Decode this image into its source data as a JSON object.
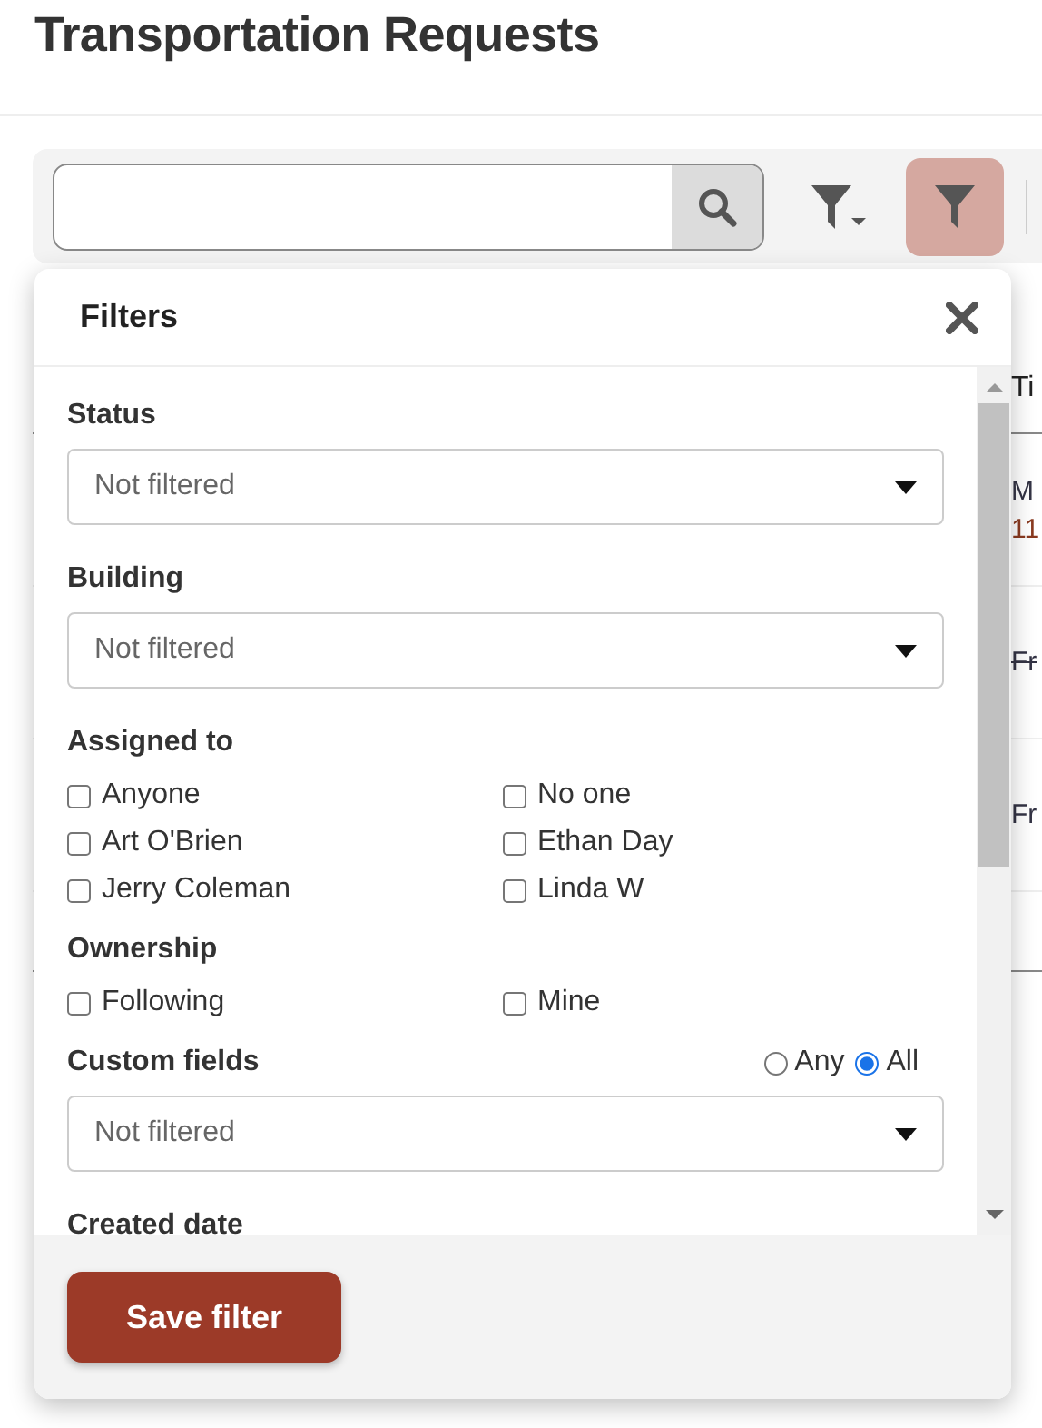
{
  "page": {
    "title": "Transportation Requests"
  },
  "toolbar": {
    "filter_toggle": {
      "active": true
    }
  },
  "background_table": {
    "header": "Ti",
    "rows": [
      {
        "lines": [
          "M",
          "11"
        ],
        "strikethrough": false
      },
      {
        "lines": [
          "Fr"
        ],
        "strikethrough": true
      },
      {
        "lines": [
          "Fr"
        ],
        "strikethrough": false
      }
    ]
  },
  "filters_panel": {
    "title": "Filters",
    "sections": [
      {
        "kind": "select",
        "label": "Status",
        "value": "Not filtered"
      },
      {
        "kind": "select",
        "label": "Building",
        "value": "Not filtered"
      },
      {
        "kind": "checkboxes",
        "label": "Assigned to",
        "options": [
          {
            "label": "Anyone",
            "checked": false
          },
          {
            "label": "No one",
            "checked": false
          },
          {
            "label": "Art O'Brien",
            "checked": false
          },
          {
            "label": "Ethan Day",
            "checked": false
          },
          {
            "label": "Jerry Coleman",
            "checked": false
          },
          {
            "label": "Linda W",
            "checked": false
          }
        ]
      },
      {
        "kind": "checkboxes",
        "label": "Ownership",
        "options": [
          {
            "label": "Following",
            "checked": false
          },
          {
            "label": "Mine",
            "checked": false
          }
        ]
      },
      {
        "kind": "select",
        "label": "Custom fields",
        "value": "Not filtered",
        "match": [
          {
            "label": "Any",
            "selected": false
          },
          {
            "label": "All",
            "selected": true
          }
        ]
      },
      {
        "kind": "heading",
        "label": "Created date"
      }
    ],
    "save_button": "Save filter"
  }
}
